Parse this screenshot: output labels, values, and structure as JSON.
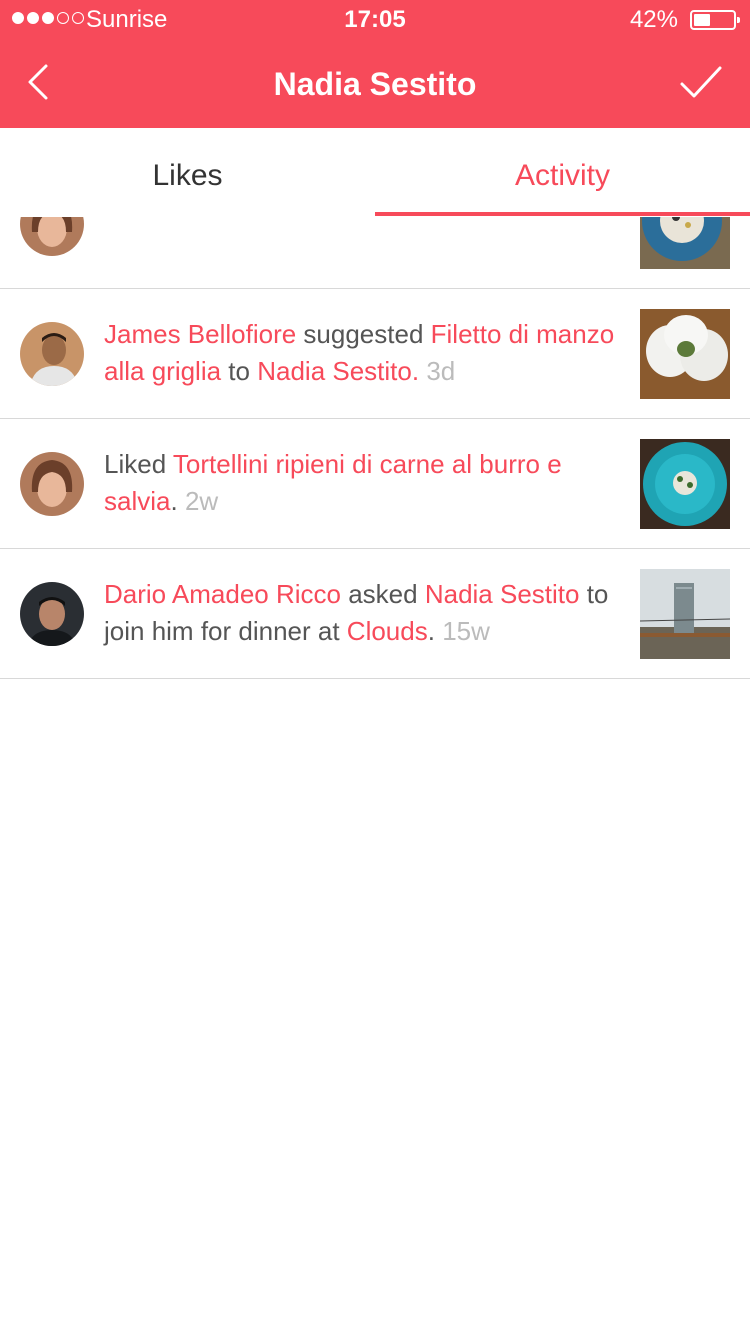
{
  "status_bar": {
    "carrier": "Sunrise",
    "time": "17:05",
    "battery_percent": "42%",
    "signal_bars_filled": 3,
    "signal_bars_total": 5,
    "battery_level": 0.42
  },
  "nav": {
    "title": "Nadia Sestito",
    "back_icon": "chevron-left-icon",
    "confirm_icon": "checkmark-icon"
  },
  "tabs": [
    {
      "label": "Likes",
      "active": false
    },
    {
      "label": "Activity",
      "active": true
    }
  ],
  "colors": {
    "accent": "#f74a5a",
    "text": "#555555",
    "muted": "#bbbbbb",
    "divider": "#d8d8d8"
  },
  "feed": [
    {
      "avatar": "woman-avatar",
      "thumbnail": "food-plate-thumbnail"
    },
    {
      "avatar": "man-avatar",
      "actor": "James Bellofiore",
      "verb": " suggested ",
      "object": "Filetto di manzo alla griglia",
      "connector": " to ",
      "target": "Nadia Sestito",
      "end": ".",
      "time": "3d",
      "thumbnail": "dumplings-thumbnail"
    },
    {
      "avatar": "woman-avatar",
      "verb": "Liked ",
      "object": "Tortellini ripieni di carne al burro e salvia",
      "end": ".",
      "time": "2w",
      "thumbnail": "teal-plate-thumbnail"
    },
    {
      "avatar": "man-dark-avatar",
      "actor": "Dario Amadeo Ricco",
      "verb": " asked ",
      "target": "Nadia Sestito",
      "connector": " to join him for dinner at ",
      "object": "Clouds",
      "end": ".",
      "time": "15w",
      "thumbnail": "tower-building-thumbnail"
    }
  ]
}
